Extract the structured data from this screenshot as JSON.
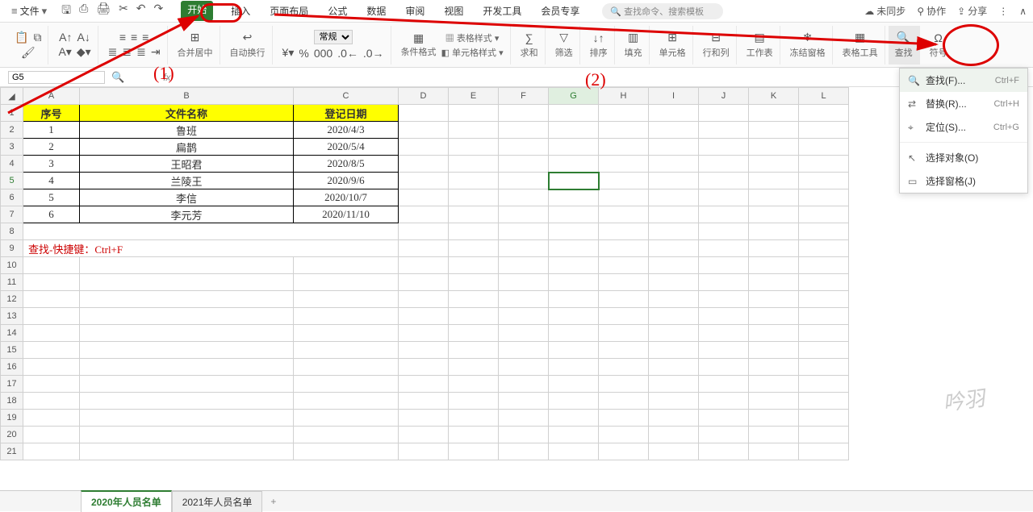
{
  "menubar": {
    "file_label": "文件",
    "tabs": [
      "开始",
      "插入",
      "页面布局",
      "公式",
      "数据",
      "审阅",
      "视图",
      "开发工具",
      "会员专享"
    ],
    "active_tab_index": 0,
    "search_placeholder": "查找命令、搜索模板",
    "right": {
      "unsync": "未同步",
      "coop": "协作",
      "share": "分享"
    }
  },
  "ribbon": {
    "merge": "合并居中",
    "wrap": "自动换行",
    "numfmt": "常规",
    "cond": "条件格式",
    "tablestyle": "表格样式",
    "cellstyle": "单元格样式",
    "sum": "求和",
    "filter": "筛选",
    "sort": "排序",
    "fill": "填充",
    "cell": "单元格",
    "rowcol": "行和列",
    "sheet": "工作表",
    "freeze": "冻结窗格",
    "tabletool": "表格工具",
    "find": "查找",
    "symbol": "符号"
  },
  "namebox": "G5",
  "columns": [
    "A",
    "B",
    "C",
    "D",
    "E",
    "F",
    "G",
    "H",
    "I",
    "J",
    "K",
    "L"
  ],
  "headers": {
    "a": "序号",
    "b": "文件名称",
    "c": "登记日期"
  },
  "rows": [
    {
      "a": "1",
      "b": "鲁班",
      "c": "2020/4/3"
    },
    {
      "a": "2",
      "b": "扁鹊",
      "c": "2020/5/4"
    },
    {
      "a": "3",
      "b": "王昭君",
      "c": "2020/8/5"
    },
    {
      "a": "4",
      "b": "兰陵王",
      "c": "2020/9/6"
    },
    {
      "a": "5",
      "b": "李信",
      "c": "2020/10/7"
    },
    {
      "a": "6",
      "b": "李元芳",
      "c": "2020/11/10"
    }
  ],
  "note": "查找-快捷键：Ctrl+F",
  "sheets": {
    "tabs": [
      "2020年人员名单",
      "2021年人员名单"
    ],
    "active": 0
  },
  "dropdown": {
    "find": "查找(F)...",
    "find_sc": "Ctrl+F",
    "replace": "替换(R)...",
    "replace_sc": "Ctrl+H",
    "goto": "定位(S)...",
    "goto_sc": "Ctrl+G",
    "selobj": "选择对象(O)",
    "selpane": "选择窗格(J)"
  },
  "annot": {
    "n1": "(1)",
    "n2": "(2)"
  },
  "watermark": "吟羽"
}
